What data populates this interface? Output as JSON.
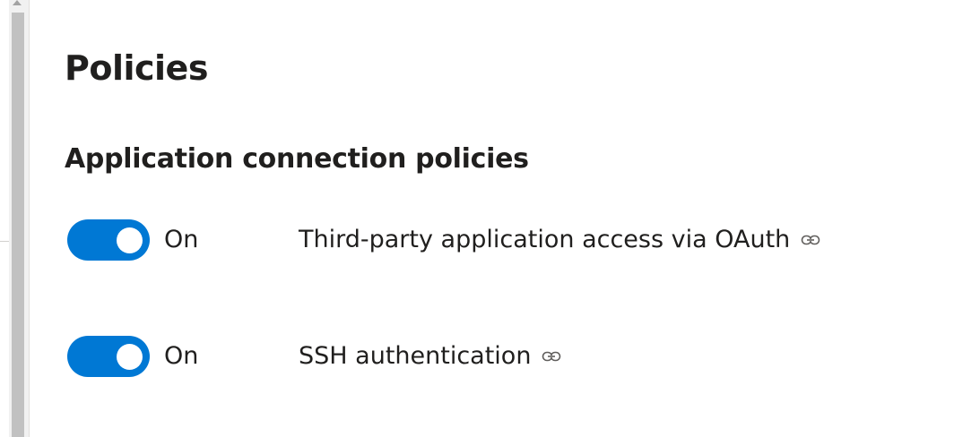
{
  "page": {
    "title": "Policies"
  },
  "section": {
    "title": "Application connection policies"
  },
  "policies": [
    {
      "toggle_state": "On",
      "enabled": true,
      "label": "Third-party application access via OAuth",
      "icon": "link-icon"
    },
    {
      "toggle_state": "On",
      "enabled": true,
      "label": "SSH authentication",
      "icon": "link-icon"
    }
  ],
  "colors": {
    "accent": "#0078d4",
    "text": "#201f1e",
    "background": "#ffffff",
    "scrollbar_thumb": "#c1c1c1"
  }
}
